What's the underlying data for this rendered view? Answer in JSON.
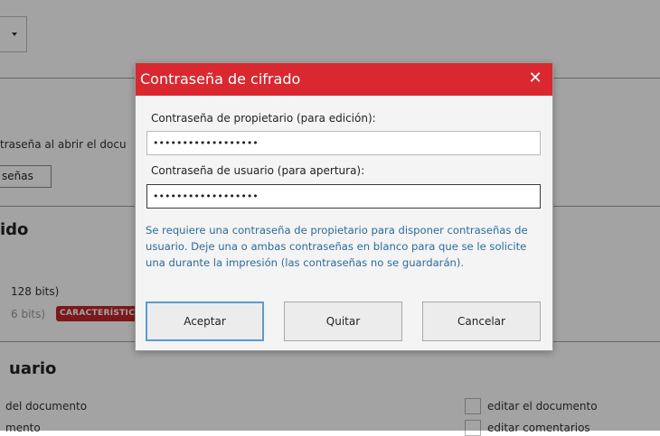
{
  "background": {
    "line_1": "traseña al abrir el docu",
    "button": "señas",
    "heading_1": "ido",
    "enc_128": "128 bits)",
    "enc_256": "6 bits)",
    "badge": "CARACTERÍSTICA",
    "heading_2": "uario",
    "perm_left_1": "del documento",
    "perm_left_2": "mento",
    "perm_right_1": "editar el documento",
    "perm_right_2": "editar comentarios"
  },
  "dialog": {
    "title": "Contraseña de cifrado",
    "close_glyph": "✕",
    "owner_label": "Contraseña de propietario (para edición):",
    "owner_value": "••••••••••••••••••",
    "user_label": "Contraseña de usuario (para apertura):",
    "user_value": "••••••••••••••••••",
    "info": "Se requiere una contraseña de propietario para disponer contraseñas de usuario. Deje una o ambas contraseñas en blanco para que se le solicite una durante la impresión (las contraseñas no se guardarán).",
    "accept_label": "Aceptar",
    "remove_label": "Quitar",
    "cancel_label": "Cancelar"
  },
  "colors": {
    "header_red": "#d9282f",
    "info_blue": "#2b6c9e",
    "focus_blue": "#5b9bd5",
    "badge_red": "#c0272d"
  }
}
